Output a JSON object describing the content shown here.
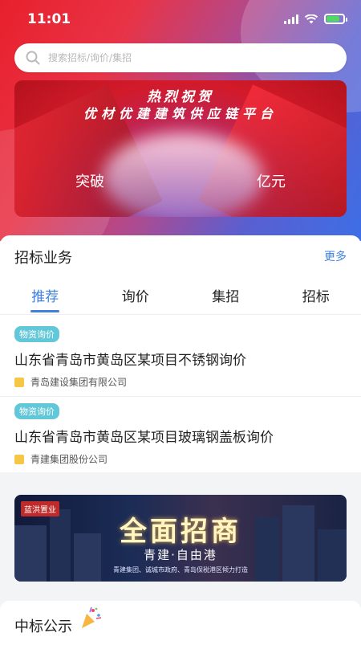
{
  "status_bar": {
    "time": "11:01"
  },
  "search": {
    "placeholder": "搜索招标/询价/集招"
  },
  "banner": {
    "line1": "热烈祝贺",
    "line2": "优材优建建筑供应链平台",
    "left_text": "突破",
    "right_text": "亿元"
  },
  "section": {
    "title": "招标业务",
    "more": "更多"
  },
  "tabs": [
    {
      "label": "推荐",
      "active": true
    },
    {
      "label": "询价",
      "active": false
    },
    {
      "label": "集招",
      "active": false
    },
    {
      "label": "招标",
      "active": false
    }
  ],
  "items": [
    {
      "tag": "物资询价",
      "title": "山东省青岛市黄岛区某项目不锈钢询价",
      "company": "青岛建设集团有限公司"
    },
    {
      "tag": "物资询价",
      "title": "山东省青岛市黄岛区某项目玻璃钢盖板询价",
      "company": "青建集团股份公司"
    }
  ],
  "promo": {
    "logo": "蓝洪置业",
    "headline": "全面招商",
    "sub": "青建·自由港",
    "note": "青建集团、诚城市政府、青岛保税港区倾力打造"
  },
  "bottom": {
    "title": "中标公示"
  },
  "colors": {
    "accent": "#3f80e0",
    "tag": "#62c7d7",
    "hero_red": "#e8202c",
    "hero_blue": "#3d6ee6"
  }
}
